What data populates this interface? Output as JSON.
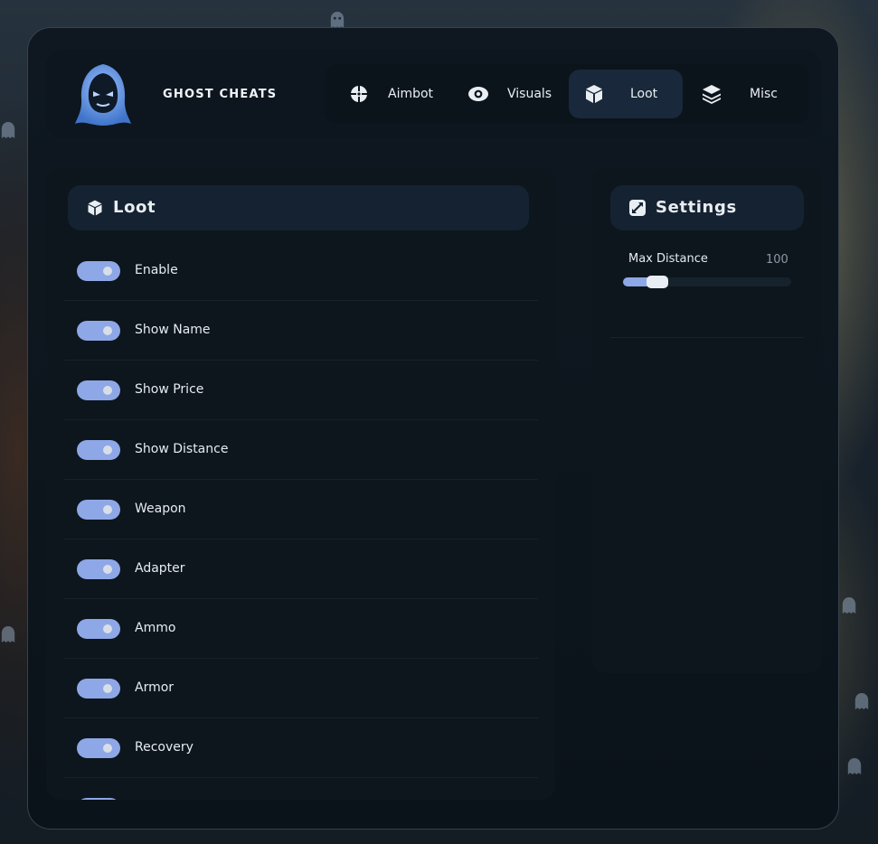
{
  "brand": {
    "name": "GHOST CHEATS",
    "accent": "#8ea7e6"
  },
  "tabs": [
    {
      "label": "Aimbot",
      "icon": "crosshair-icon",
      "active": false
    },
    {
      "label": "Visuals",
      "icon": "eye-icon",
      "active": false
    },
    {
      "label": "Loot",
      "icon": "cube-icon",
      "active": true
    },
    {
      "label": "Misc",
      "icon": "layers-icon",
      "active": false
    }
  ],
  "loot": {
    "title": "Loot",
    "icon": "cube-icon",
    "items": [
      {
        "label": "Enable",
        "on": true
      },
      {
        "label": "Show Name",
        "on": true
      },
      {
        "label": "Show Price",
        "on": true
      },
      {
        "label": "Show Distance",
        "on": true
      },
      {
        "label": "Weapon",
        "on": true
      },
      {
        "label": "Adapter",
        "on": true
      },
      {
        "label": "Ammo",
        "on": true
      },
      {
        "label": "Armor",
        "on": true
      },
      {
        "label": "Recovery",
        "on": true
      },
      {
        "label": "",
        "on": true
      }
    ]
  },
  "settings": {
    "title": "Settings",
    "icon": "resize-icon",
    "max_distance": {
      "label": "Max Distance",
      "value": "100",
      "fraction": 0.16
    }
  }
}
